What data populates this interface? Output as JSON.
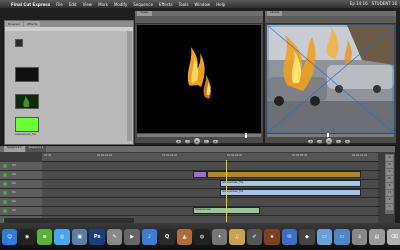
{
  "menubar": {
    "app": "Final Cut Express",
    "items": [
      "File",
      "Edit",
      "View",
      "Mark",
      "Modify",
      "Sequence",
      "Effects",
      "Tools",
      "Window",
      "Help"
    ],
    "clock": "Ep 14:16",
    "user": "STUDENT 16"
  },
  "browser": {
    "tabs": [
      "Browser",
      "Effects"
    ],
    "clips": [
      {
        "label": "",
        "color": "#2b2b2b"
      },
      {
        "label": "",
        "color": "#111111"
      },
      {
        "label": "",
        "color": "#0c2a0c"
      },
      {
        "label": "",
        "color": "#6dff35"
      }
    ],
    "clip_name_last": "Greenscreen_fire"
  },
  "viewer": {
    "tabs": [
      "Viewer"
    ],
    "timecode": "00:00:06:00"
  },
  "canvas": {
    "tabs": [
      "Canvas"
    ],
    "timecode": "00:00:06:00"
  },
  "timeline": {
    "tabs": [
      "Sequence 1",
      "Sequence 2"
    ],
    "ruler": [
      "00:00",
      "00:00:02:00",
      "00:00:04:00",
      "00:00:06:00",
      "00:00:08:00",
      "00:00:10:00"
    ],
    "tracks": [
      {
        "label": "V3",
        "clips": []
      },
      {
        "label": "V2",
        "clips": [
          {
            "name": "",
            "color": "#9b6fd0",
            "start": 0.45,
            "end": 0.49
          },
          {
            "name": "",
            "color": "#b6852a",
            "start": 0.49,
            "end": 0.95
          }
        ]
      },
      {
        "label": "V1",
        "clips": [
          {
            "name": "Greenscreen_fire",
            "color": "#a9c6e6",
            "start": 0.53,
            "end": 0.95
          }
        ]
      },
      {
        "label": "V1",
        "clips": [
          {
            "name": "Greenscreen_fire",
            "color": "#a9c6e6",
            "start": 0.53,
            "end": 0.95
          }
        ]
      },
      {
        "label": "A1",
        "clips": []
      },
      {
        "label": "A2",
        "clips": [
          {
            "name": "Greenscreen",
            "color": "#9cc79c",
            "start": 0.45,
            "end": 0.65
          }
        ]
      },
      {
        "label": "A3",
        "clips": []
      }
    ]
  },
  "tools": [
    "A",
    "R",
    "S",
    "B",
    "Z",
    "H",
    "P",
    "C"
  ],
  "dock": [
    {
      "name": "finder-icon",
      "color": "#2f7bd6",
      "glyph": "☺"
    },
    {
      "name": "dashboard-icon",
      "color": "#222222",
      "glyph": "◉"
    },
    {
      "name": "spotify-icon",
      "color": "#58b13a",
      "glyph": "≋"
    },
    {
      "name": "safari-icon",
      "color": "#4aa6e8",
      "glyph": "◎"
    },
    {
      "name": "iphoto-icon",
      "color": "#5d7ea8",
      "glyph": "▣"
    },
    {
      "name": "photoshop-icon",
      "color": "#1a3f7a",
      "glyph": "Ps"
    },
    {
      "name": "fcp-icon",
      "color": "#888888",
      "glyph": "✎"
    },
    {
      "name": "camera-icon",
      "color": "#666666",
      "glyph": "▶"
    },
    {
      "name": "itunes-icon",
      "color": "#3c7fd0",
      "glyph": "♪"
    },
    {
      "name": "quicktime-icon",
      "color": "#2a2a2a",
      "glyph": "Q"
    },
    {
      "name": "keynote-icon",
      "color": "#b06b3a",
      "glyph": "▲"
    },
    {
      "name": "dvd-icon",
      "color": "#222222",
      "glyph": "◍"
    },
    {
      "name": "preview-icon",
      "color": "#777777",
      "glyph": "✦"
    },
    {
      "name": "garageband-icon",
      "color": "#c8a050",
      "glyph": "♫"
    },
    {
      "name": "sketch-icon",
      "color": "#555555",
      "glyph": "✐"
    },
    {
      "name": "movie-icon",
      "color": "#7a4020",
      "glyph": "★"
    },
    {
      "name": "mail-icon",
      "color": "#3a6fc6",
      "glyph": "✉"
    },
    {
      "name": "appstore-icon",
      "color": "#444444",
      "glyph": "◆"
    },
    {
      "name": "folder-icon",
      "color": "#6aa0d8",
      "glyph": "▭"
    },
    {
      "name": "folder2-icon",
      "color": "#4f86c6",
      "glyph": "▭"
    },
    {
      "name": "downloads-icon",
      "color": "#888888",
      "glyph": "⇩"
    },
    {
      "name": "documents-icon",
      "color": "#9a9a9a",
      "glyph": "▤"
    },
    {
      "name": "trash-icon",
      "color": "#b0b0b0",
      "glyph": "⌫"
    }
  ]
}
